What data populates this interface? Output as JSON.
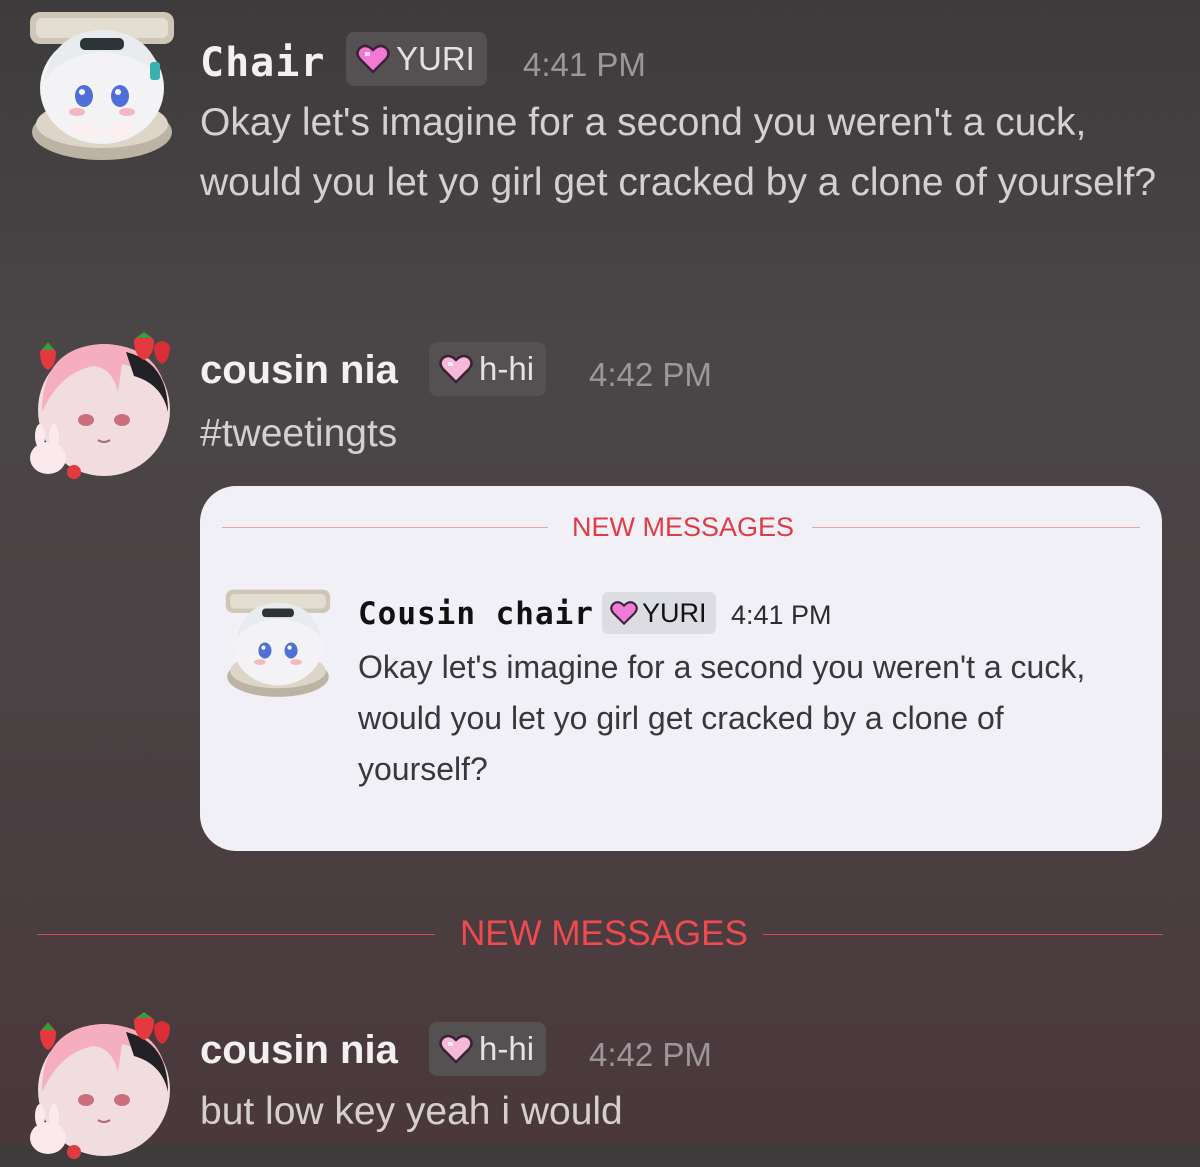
{
  "messages": [
    {
      "author": "Chair",
      "role": "YURI",
      "time": "4:41 PM",
      "text": "Okay let's imagine for a second you weren't a cuck, would you let yo girl get cracked by a clone of yourself?"
    },
    {
      "author": "cousin nia",
      "role": "h-hi",
      "time": "4:42 PM",
      "text": "#tweetingts"
    },
    {
      "author": "cousin nia",
      "role": "h-hi",
      "time": "4:42 PM",
      "text": "but low key yeah i would"
    }
  ],
  "embed": {
    "divider_label": "NEW MESSAGES",
    "author": "Cousin chair",
    "role": "YURI",
    "time": "4:41 PM",
    "text": "Okay let's imagine for a second you weren't a cuck, would you let yo girl get cracked by a clone of yourself?"
  },
  "divider": {
    "label": "NEW MESSAGES"
  },
  "colors": {
    "new_messages_red": "#ef4a50",
    "role_heart_pink": "#f07ad4",
    "role_heart_light": "#f4b9d8",
    "card_background": "#f1f0f7"
  }
}
